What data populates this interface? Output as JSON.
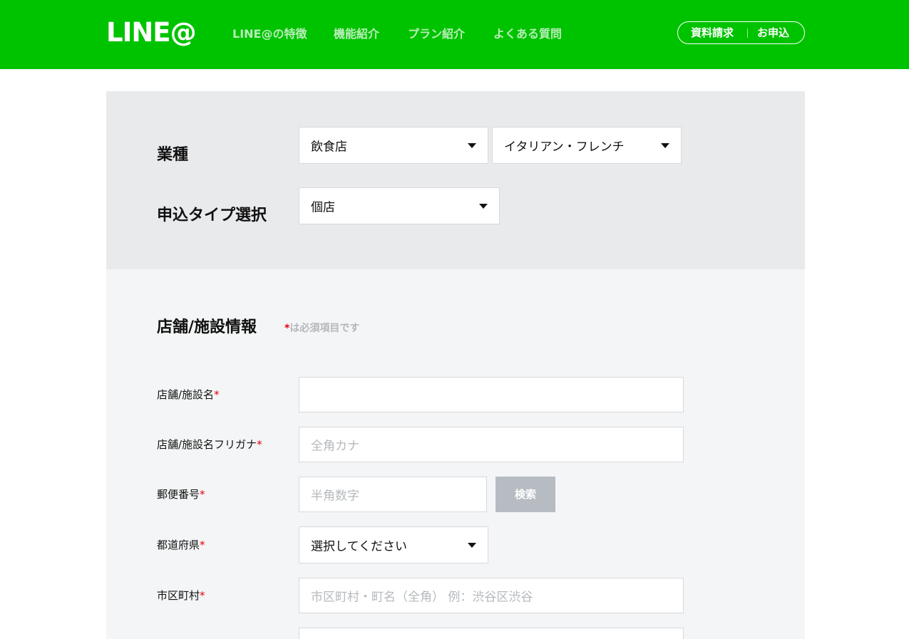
{
  "header": {
    "logo": "LINE@",
    "nav": [
      "LINE@の特徴",
      "機能紹介",
      "プラン紹介",
      "よくある質問"
    ],
    "pill": {
      "request_docs": "資料請求",
      "apply": "お申込"
    }
  },
  "selection": {
    "industry_label": "業種",
    "industry_value": "飲食店",
    "subindustry_value": "イタリアン・フレンチ",
    "type_label": "申込タイプ選択",
    "type_value": "個店"
  },
  "form": {
    "section_title": "店舗/施設情報",
    "required_mark": "*",
    "required_note": "は必須項目です",
    "fields": [
      {
        "label": "店舗/施設名",
        "placeholder": ""
      },
      {
        "label": "店舗/施設名フリガナ",
        "placeholder": "全角カナ"
      },
      {
        "label": "郵便番号",
        "placeholder": "半角数字"
      },
      {
        "label": "都道府県",
        "value": "選択してください"
      },
      {
        "label": "市区町村",
        "placeholder": "市区町村・町名（全角） 例：渋谷区渋谷"
      }
    ],
    "search_button": "検索"
  },
  "colors": {
    "brand_green": "#00c300",
    "required_red": "#e60012",
    "panel_top_bg": "#e8eaec",
    "panel_form_bg": "#f4f5f6",
    "search_button_bg": "#b7bcc2"
  }
}
